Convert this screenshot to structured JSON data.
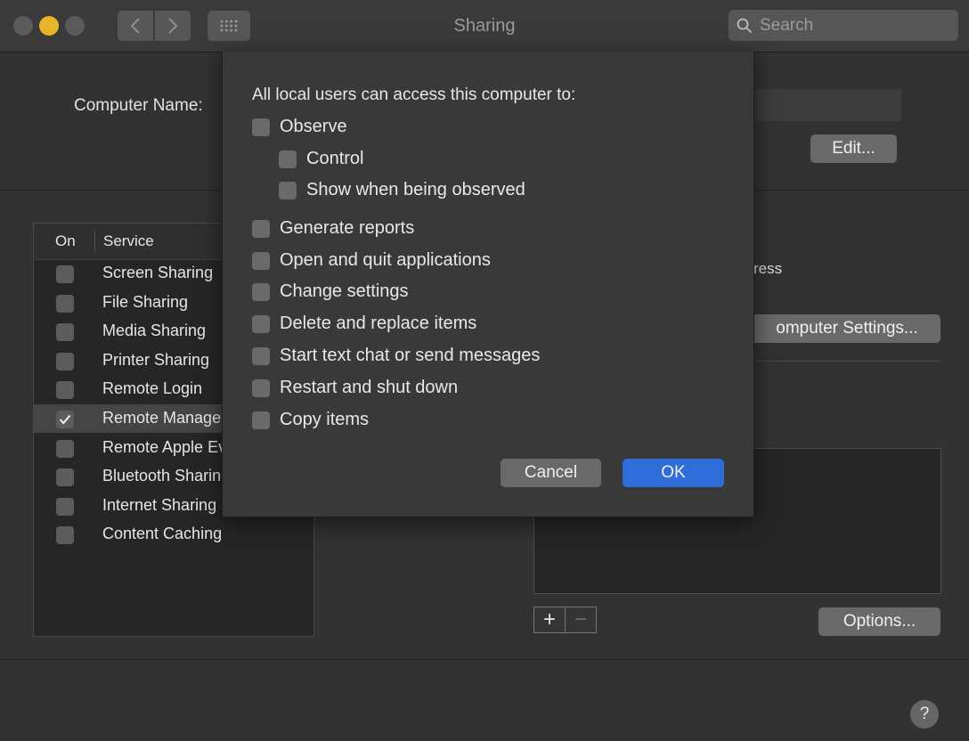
{
  "window": {
    "title": "Sharing",
    "search_placeholder": "Search"
  },
  "computer_name": {
    "label": "Computer Name:",
    "edit_button": "Edit..."
  },
  "services": {
    "header_on": "On",
    "header_service": "Service",
    "items": [
      {
        "label": "Screen Sharing",
        "checked": false
      },
      {
        "label": "File Sharing",
        "checked": false
      },
      {
        "label": "Media Sharing",
        "checked": false
      },
      {
        "label": "Printer Sharing",
        "checked": false
      },
      {
        "label": "Remote Login",
        "checked": false
      },
      {
        "label": "Remote Management",
        "checked": true,
        "selected": true
      },
      {
        "label": "Remote Apple Events",
        "checked": false
      },
      {
        "label": "Bluetooth Sharing",
        "checked": false
      },
      {
        "label": "Internet Sharing",
        "checked": false
      },
      {
        "label": "Content Caching",
        "checked": false
      }
    ]
  },
  "right_pane": {
    "status_partial": "ress",
    "computer_settings_button": "omputer Settings...",
    "add_button": "+",
    "remove_button": "−",
    "options_button": "Options...",
    "help_button": "?"
  },
  "dialog": {
    "title": "All local users can access this computer to:",
    "options": [
      {
        "label": "Observe",
        "checked": false
      },
      {
        "label": "Control",
        "checked": false
      },
      {
        "label": "Show when being observed",
        "checked": false
      },
      {
        "label": "Generate reports",
        "checked": false
      },
      {
        "label": "Open and quit applications",
        "checked": false
      },
      {
        "label": "Change settings",
        "checked": false
      },
      {
        "label": "Delete and replace items",
        "checked": false
      },
      {
        "label": "Start text chat or send messages",
        "checked": false
      },
      {
        "label": "Restart and shut down",
        "checked": false
      },
      {
        "label": "Copy items",
        "checked": false
      }
    ],
    "cancel_button": "Cancel",
    "ok_button": "OK"
  },
  "colors": {
    "accent": "#2f6ddb",
    "minimize": "#e8b52a"
  }
}
